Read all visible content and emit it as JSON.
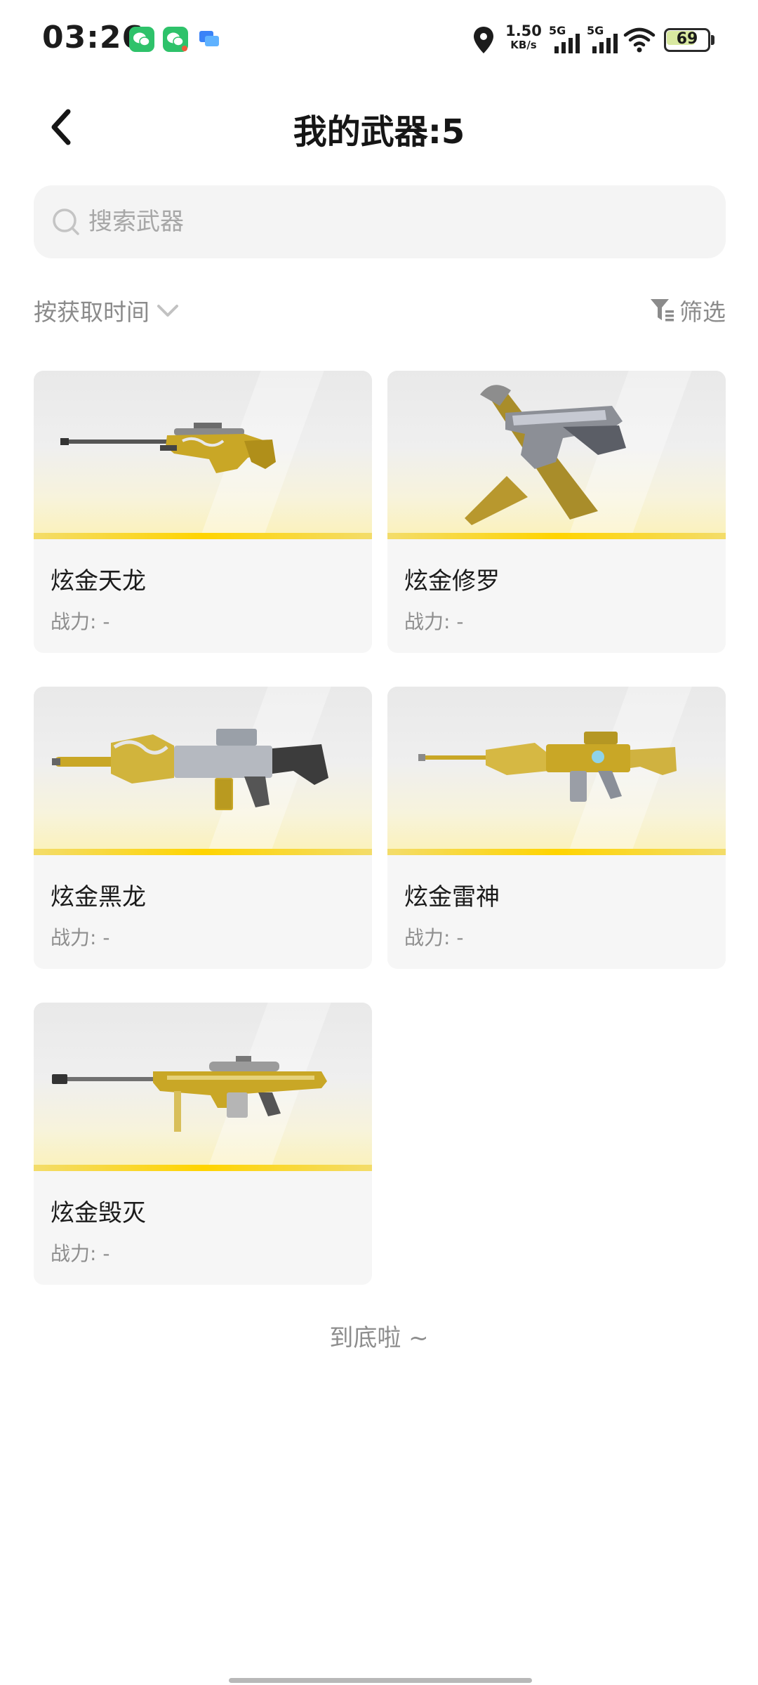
{
  "status_bar": {
    "time": "03:26",
    "net_speed_value": "1.50",
    "net_speed_unit": "KB/s",
    "signal_1_label": "5G",
    "signal_2_label": "5G",
    "battery_level": "69",
    "battery_fraction": 0.69,
    "notification_icons": [
      "wechat-icon",
      "wechat-icon",
      "message-icon"
    ]
  },
  "header": {
    "title": "我的武器:5",
    "back_icon": "chevron-left-icon"
  },
  "search": {
    "placeholder": "搜索武器",
    "value": ""
  },
  "toolbar": {
    "sort_label": "按获取时间",
    "filter_label": "筛选"
  },
  "weapons": [
    {
      "name": "炫金天龙",
      "power": "战力: -"
    },
    {
      "name": "炫金修罗",
      "power": "战力: -"
    },
    {
      "name": "炫金黑龙",
      "power": "战力: -"
    },
    {
      "name": "炫金雷神",
      "power": "战力: -"
    },
    {
      "name": "炫金毁灭",
      "power": "战力: -"
    }
  ],
  "footer": {
    "end_text": "到底啦 ~"
  },
  "colors": {
    "accent_gold": "#ffd400",
    "text_secondary": "#8b8b8b",
    "card_bg": "#f6f6f6"
  }
}
